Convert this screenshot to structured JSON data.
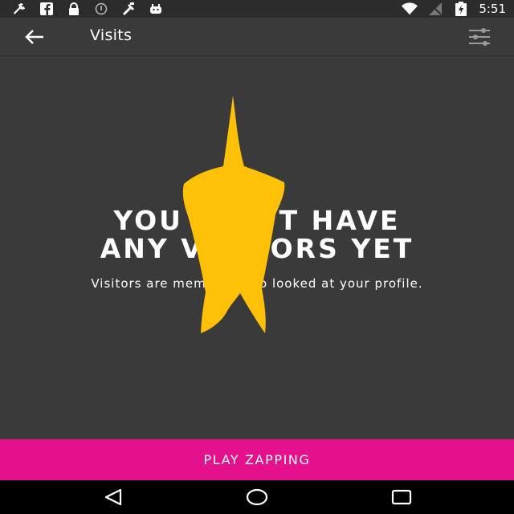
{
  "status_bar": {
    "time": "5:51",
    "icons": [
      "wrench-icon",
      "facebook-icon",
      "lock-icon",
      "info-icon",
      "tools-icon",
      "android-icon",
      "wifi-icon",
      "signal-icon",
      "battery-charging-icon"
    ]
  },
  "app_bar": {
    "title": "Visits",
    "back_icon": "arrow-left-icon",
    "filter_icon": "sliders-icon"
  },
  "empty_state": {
    "title_line1": "YOU DON'T HAVE",
    "title_line2": "ANY VISITORS YET",
    "subtitle": "Visitors are members who looked at your profile."
  },
  "cta": {
    "label": "PLAY ZAPPING"
  },
  "colors": {
    "background": "#3a3a3a",
    "accent": "#e5118c",
    "logo": "#ffc107"
  },
  "nav_bar": {
    "icons": [
      "back-triangle-icon",
      "home-circle-icon",
      "recents-square-icon"
    ]
  }
}
